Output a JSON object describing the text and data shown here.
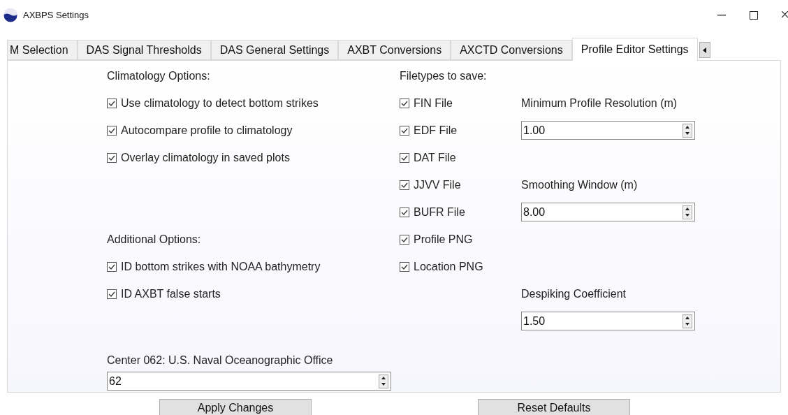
{
  "window": {
    "title": "AXBPS Settings"
  },
  "tabs": [
    {
      "label": "M Selection",
      "selected": false
    },
    {
      "label": "DAS Signal Thresholds",
      "selected": false
    },
    {
      "label": "DAS General Settings",
      "selected": false
    },
    {
      "label": "AXBT Conversions",
      "selected": false
    },
    {
      "label": "AXCTD Conversions",
      "selected": false
    },
    {
      "label": "Profile Editor Settings",
      "selected": true
    }
  ],
  "climatology": {
    "heading": "Climatology Options:",
    "options": [
      {
        "label": "Use climatology to detect bottom strikes",
        "checked": true
      },
      {
        "label": "Autocompare profile to climatology",
        "checked": true
      },
      {
        "label": "Overlay climatology in saved plots",
        "checked": true
      }
    ]
  },
  "additional": {
    "heading": "Additional Options:",
    "options": [
      {
        "label": "ID bottom strikes with NOAA bathymetry",
        "checked": true
      },
      {
        "label": "ID AXBT false starts",
        "checked": true
      }
    ]
  },
  "center": {
    "label": "Center 062: U.S. Naval Oceanographic Office",
    "value": "62"
  },
  "filetypes": {
    "heading": "Filetypes to save:",
    "options": [
      {
        "label": "FIN File",
        "checked": true
      },
      {
        "label": "EDF File",
        "checked": true
      },
      {
        "label": "DAT File",
        "checked": true
      },
      {
        "label": "JJVV File",
        "checked": true
      },
      {
        "label": "BUFR File",
        "checked": true
      },
      {
        "label": "Profile PNG",
        "checked": true
      },
      {
        "label": "Location PNG",
        "checked": true
      }
    ]
  },
  "parameters": [
    {
      "label": "Minimum Profile Resolution (m)",
      "value": "1.00"
    },
    {
      "label": "Smoothing Window (m)",
      "value": "8.00"
    },
    {
      "label": "Despiking Coefficient",
      "value": "1.50"
    }
  ],
  "buttons": [
    "Apply Changes",
    "Reset Defaults"
  ]
}
